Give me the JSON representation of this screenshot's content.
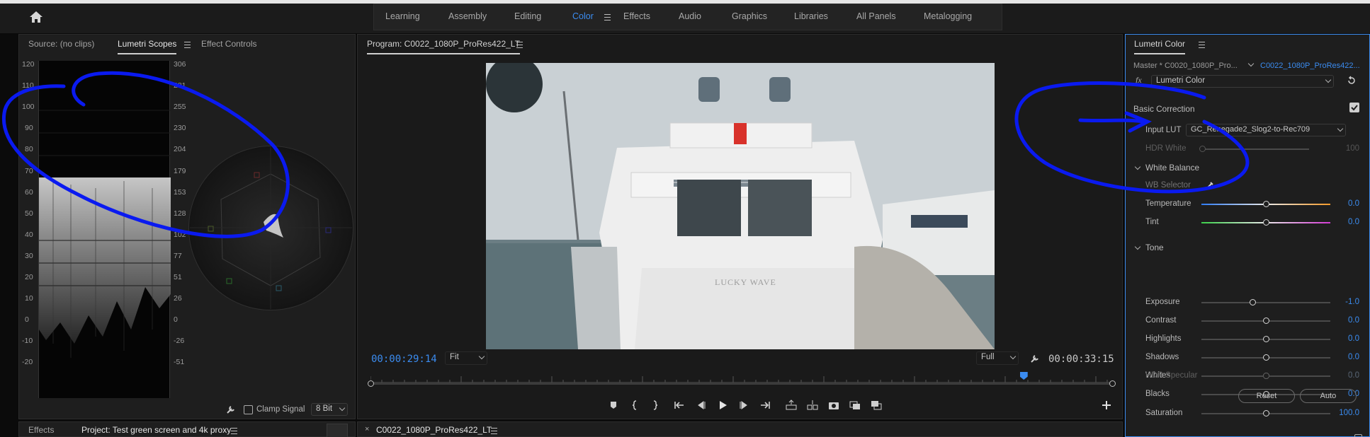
{
  "topbar": {
    "home_icon": "home-icon",
    "workspaces": [
      "Learning",
      "Assembly",
      "Editing",
      "Color",
      "Effects",
      "Audio",
      "Graphics",
      "Libraries",
      "All Panels",
      "Metalogging"
    ],
    "active_workspace": "Color"
  },
  "source_panel": {
    "tabs": [
      "Source: (no clips)",
      "Lumetri Scopes",
      "Effect Controls"
    ],
    "active_tab": "Lumetri Scopes",
    "left_scale": [
      "120",
      "110",
      "100",
      "90",
      "80",
      "70",
      "60",
      "50",
      "40",
      "30",
      "20",
      "10",
      "0",
      "-10",
      "-20"
    ],
    "right_scale": [
      "306",
      "281",
      "255",
      "230",
      "204",
      "179",
      "153",
      "128",
      "102",
      "77",
      "51",
      "26",
      "0",
      "-26",
      "-51"
    ],
    "clamp_signal_label": "Clamp Signal",
    "bit_depth": "8 Bit"
  },
  "program_monitor": {
    "title": "Program: C0022_1080P_ProRes422_LT",
    "current_timecode": "00:00:29:14",
    "fit": "Fit",
    "resolution": "Full",
    "duration_timecode": "00:00:33:15",
    "playhead_position": 0.88,
    "video_caption": "LUCKY WAVE"
  },
  "lumetri": {
    "title": "Lumetri Color",
    "master_clip": "Master * C0020_1080P_Pro...",
    "clip": "C0022_1080P_ProRes422...",
    "fx_label": "fx",
    "effect": "Lumetri Color",
    "basic_correction": "Basic Correction",
    "input_lut_label": "Input LUT",
    "input_lut_value": "GC_Renegade2_Slog2-to-Rec709",
    "hdr_white_label": "HDR White",
    "hdr_white_value": "100",
    "white_balance": "White Balance",
    "wb_selector": "WB Selector",
    "temperature_label": "Temperature",
    "temperature_value": "0.0",
    "tint_label": "Tint",
    "tint_value": "0.0",
    "tone": "Tone",
    "tone_rows": [
      {
        "label": "Exposure",
        "value": "-1.0",
        "level": 0.4
      },
      {
        "label": "Contrast",
        "value": "0.0",
        "level": 0.5
      },
      {
        "label": "Highlights",
        "value": "0.0",
        "level": 0.5
      },
      {
        "label": "Shadows",
        "value": "0.0",
        "level": 0.5
      },
      {
        "label": "Whites",
        "value": "0.0",
        "level": 0.5
      },
      {
        "label": "Blacks",
        "value": "0.0",
        "level": 0.5
      }
    ],
    "hdr_specular_label": "HDR Specular",
    "hdr_specular_value": "0.0",
    "reset_label": "Reset",
    "auto_label": "Auto",
    "saturation_label": "Saturation",
    "saturation_value": "100.0"
  },
  "bottom": {
    "effects_tab": "Effects",
    "project_tab": "Project: Test green screen and 4k proxy",
    "timeline_tab": "C0022_1080P_ProRes422_LT"
  },
  "annotation_color": "#0a1af0"
}
